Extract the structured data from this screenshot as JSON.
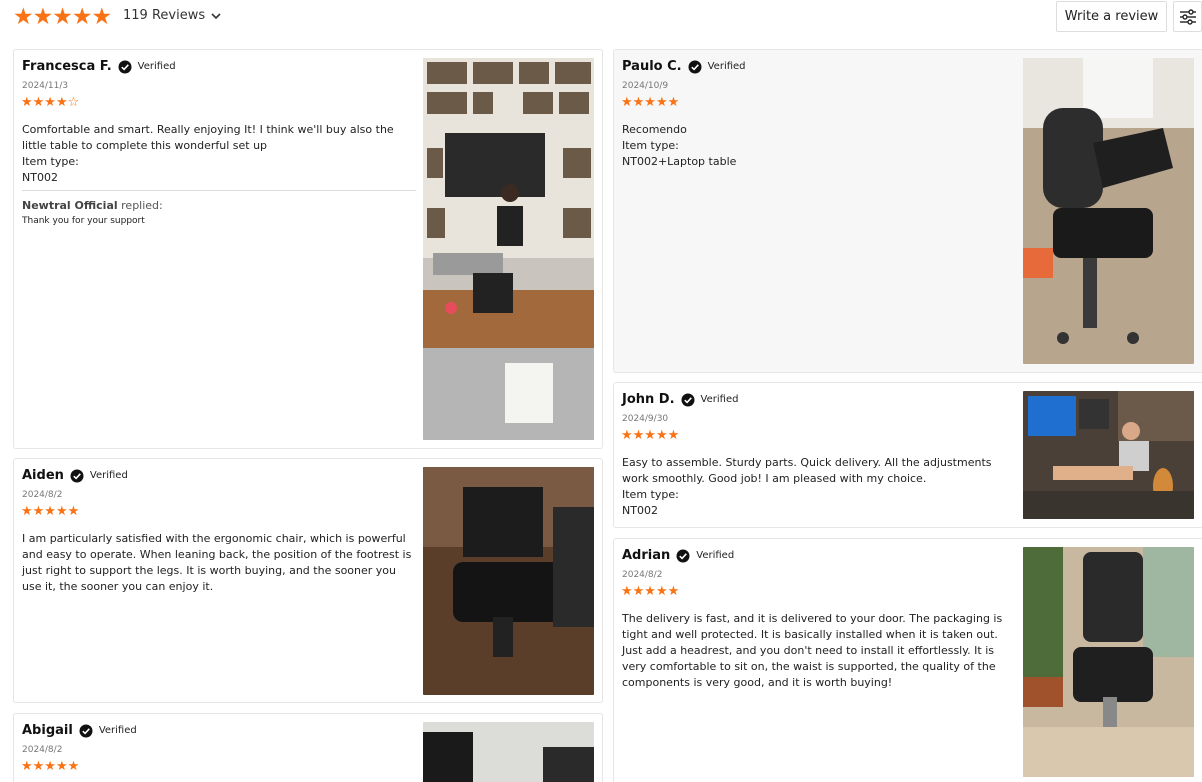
{
  "summary": {
    "rating": 5,
    "reviews_label": "119 Reviews"
  },
  "toolbar": {
    "write_review_label": "Write a review"
  },
  "colors": {
    "star": "#f97316",
    "border": "#e6e6e6"
  },
  "reviews": [
    {
      "name": "Francesca F.",
      "verified": "Verified",
      "date": "2024/11/3",
      "rating": 4,
      "body": [
        "Comfortable and smart. Really enjoying It! I think we'll buy also the",
        "little table to complete this wonderful set up",
        "Item type:",
        "NT002"
      ],
      "reply": {
        "author": "Newtral Official",
        "verb": "replied:",
        "text": "Thank you for your support"
      }
    },
    {
      "name": "Aiden",
      "verified": "Verified",
      "date": "2024/8/2",
      "rating": 5,
      "body": [
        "I am particularly satisfied with the ergonomic chair, which is powerful",
        "and easy to operate. When leaning back, the position of the footrest is",
        "just right to support the legs. It is worth buying, and the sooner you",
        "use it, the sooner you can enjoy it."
      ]
    },
    {
      "name": "Abigail",
      "verified": "Verified",
      "date": "2024/8/2",
      "rating": 5,
      "body": []
    },
    {
      "name": "Paulo C.",
      "verified": "Verified",
      "date": "2024/10/9",
      "rating": 5,
      "body": [
        "Recomendo",
        "Item type:",
        "NT002+Laptop table"
      ]
    },
    {
      "name": "John D.",
      "verified": "Verified",
      "date": "2024/9/30",
      "rating": 5,
      "body": [
        "Easy to assemble. Sturdy parts. Quick delivery. All the adjustments",
        "work smoothly. Good job! I am pleased with my choice.",
        "Item type:",
        "NT002"
      ]
    },
    {
      "name": "Adrian",
      "verified": "Verified",
      "date": "2024/8/2",
      "rating": 5,
      "body": [
        "The delivery is fast, and it is delivered to your door. The packaging is",
        "tight and well protected. It is basically installed when it is taken out.",
        "Just add a headrest, and you don't need to install it effortlessly. It is",
        "very comfortable to sit on, the waist is supported, the quality of the",
        "components is very good, and it is worth buying!"
      ]
    }
  ]
}
